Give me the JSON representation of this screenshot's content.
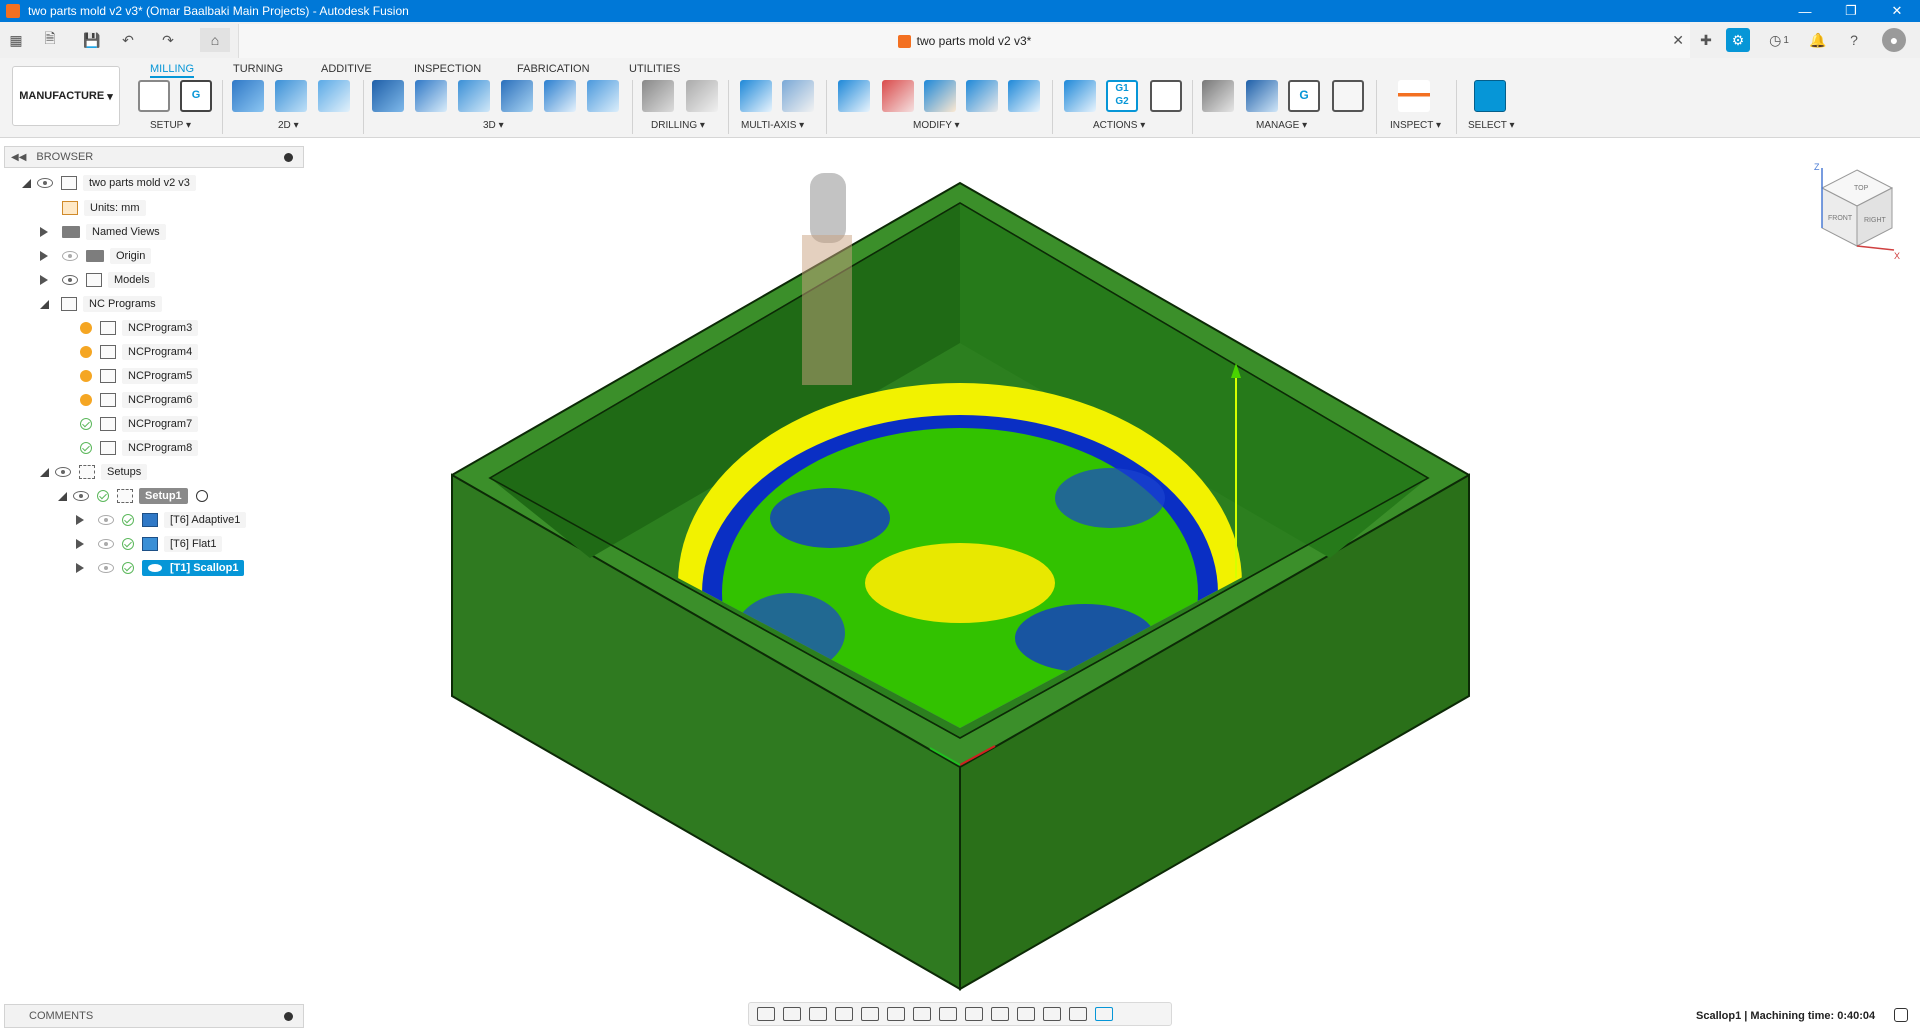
{
  "window": {
    "title": "two parts mold v2 v3* (Omar Baalbaki Main Projects) - Autodesk Fusion",
    "controls": [
      "minimize-icon",
      "restore-icon",
      "close-icon"
    ]
  },
  "header": {
    "doc_tab_title": "two parts mold v2 v3*",
    "notification_count": "1"
  },
  "ribbon": {
    "workspace": "MANUFACTURE",
    "tabs": [
      "MILLING",
      "TURNING",
      "ADDITIVE",
      "INSPECTION",
      "FABRICATION",
      "UTILITIES"
    ],
    "active_tab": "MILLING",
    "groups": [
      "SETUP",
      "2D",
      "3D",
      "DRILLING",
      "MULTI-AXIS",
      "MODIFY",
      "ACTIONS",
      "MANAGE",
      "INSPECT",
      "SELECT"
    ],
    "g1g2_text": "G1 G2"
  },
  "browser": {
    "title": "BROWSER",
    "root": "two parts mold v2 v3",
    "units": "Units: mm",
    "named_views": "Named Views",
    "origin": "Origin",
    "models": "Models",
    "nc_programs": "NC Programs",
    "programs": [
      "NCProgram3",
      "NCProgram4",
      "NCProgram5",
      "NCProgram6",
      "NCProgram7",
      "NCProgram8"
    ],
    "setups": "Setups",
    "setup1": "Setup1",
    "operations": [
      "[T6] Adaptive1",
      "[T6] Flat1",
      "[T1] Scallop1"
    ]
  },
  "comments": {
    "title": "COMMENTS"
  },
  "viewcube": {
    "top": "TOP",
    "front": "FRONT",
    "right": "RIGHT",
    "x": "X",
    "z": "Z"
  },
  "status": {
    "text": "Scallop1 | Machining time: 0:40:04"
  },
  "colors": {
    "titlebar": "#0078d7",
    "accent": "#0696d7",
    "stock_green": "#2e7d1e",
    "toolpath_yellow": "#f6f600",
    "toolpath_blue": "#0a2fc4"
  }
}
